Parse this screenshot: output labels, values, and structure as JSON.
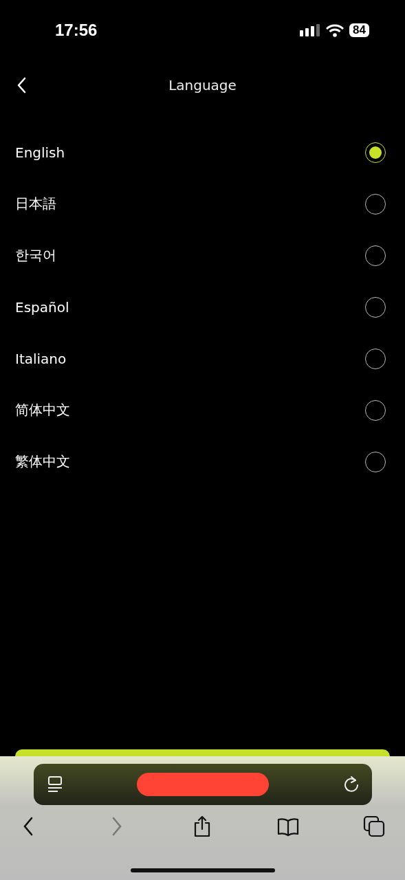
{
  "status_bar": {
    "time": "17:56",
    "battery": "84"
  },
  "header": {
    "title": "Language"
  },
  "languages": [
    {
      "label": "English",
      "selected": true
    },
    {
      "label": "日本語",
      "selected": false
    },
    {
      "label": "한국어",
      "selected": false
    },
    {
      "label": "Español",
      "selected": false
    },
    {
      "label": "Italiano",
      "selected": false
    },
    {
      "label": "简体中文",
      "selected": false
    },
    {
      "label": "繁体中文",
      "selected": false
    }
  ],
  "browser_toolbar": {
    "buttons": [
      {
        "kind": "back",
        "disabled": false
      },
      {
        "kind": "forward",
        "disabled": true
      },
      {
        "kind": "share",
        "disabled": false
      },
      {
        "kind": "bookmarks",
        "disabled": false
      },
      {
        "kind": "tabs",
        "disabled": false
      }
    ]
  }
}
